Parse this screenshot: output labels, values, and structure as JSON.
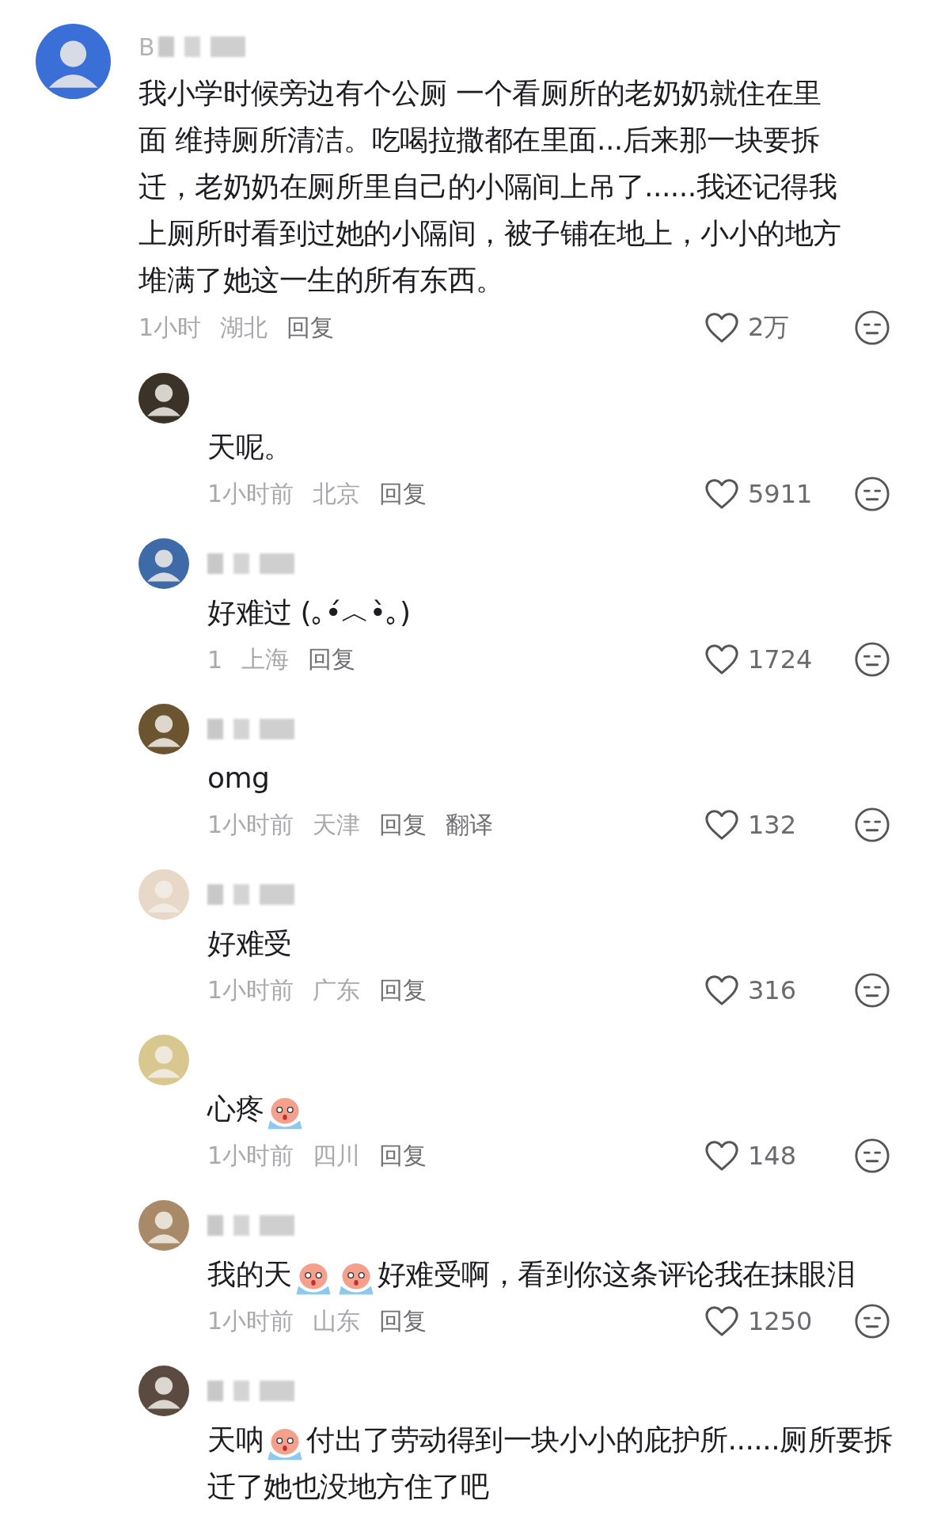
{
  "comments": [
    {
      "username": "B",
      "name_redacted": true,
      "content": [
        {
          "kind": "text",
          "text": "我小学时候旁边有个公厕 一个看厕所的老奶奶就住在里面 维持厕所清洁。吃喝拉撒都在里面...后来那一块要拆迁，老奶奶在厕所里自己的小隔间上吊了......我还记得我上厕所时看到过她的小隔间，被子铺在地上，小小的地方堆满了她这一生的所有东西。"
        }
      ],
      "time": "1小时",
      "location": "湖北",
      "reply": "回复",
      "likes": "2万"
    },
    {
      "name_redacted": false,
      "content": [
        {
          "kind": "text",
          "text": "天呢。"
        }
      ],
      "time": "1小时前",
      "location": "北京",
      "reply": "回复",
      "likes": "5911"
    },
    {
      "name_redacted": true,
      "content": [
        {
          "kind": "text",
          "text": "好难过 (｡•́︿•̀｡)"
        }
      ],
      "time": "1",
      "location": "上海",
      "reply": "回复",
      "likes": "1724"
    },
    {
      "name_redacted": true,
      "content": [
        {
          "kind": "text",
          "text": "omg"
        }
      ],
      "time": "1小时前",
      "location": "天津",
      "reply": "回复",
      "translate": "翻译",
      "likes": "132"
    },
    {
      "name_redacted": true,
      "content": [
        {
          "kind": "text",
          "text": "好难受"
        }
      ],
      "time": "1小时前",
      "location": "广东",
      "reply": "回复",
      "likes": "316"
    },
    {
      "name_redacted": false,
      "content": [
        {
          "kind": "text",
          "text": "心疼"
        },
        {
          "kind": "emoji"
        }
      ],
      "time": "1小时前",
      "location": "四川",
      "reply": "回复",
      "likes": "148"
    },
    {
      "name_redacted": true,
      "content": [
        {
          "kind": "text",
          "text": "我的天"
        },
        {
          "kind": "emoji"
        },
        {
          "kind": "emoji"
        },
        {
          "kind": "text",
          "text": "好难受啊，看到你这条评论我在抹眼泪"
        }
      ],
      "time": "1小时前",
      "location": "山东",
      "reply": "回复",
      "likes": "1250"
    },
    {
      "name_redacted": true,
      "content": [
        {
          "kind": "text",
          "text": "天呐"
        },
        {
          "kind": "emoji"
        },
        {
          "kind": "text",
          "text": "付出了劳动得到一块小小的庇护所......厕所要拆迁了她也没地方住了吧"
        }
      ]
    }
  ]
}
